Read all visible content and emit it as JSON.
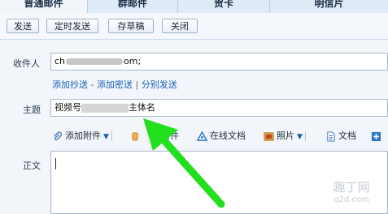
{
  "tabs": [
    "普通邮件",
    "群邮件",
    "贺卡",
    "明信片"
  ],
  "toolbar": {
    "send": "发送",
    "scheduled_send": "定时发送",
    "save_draft": "存草稿",
    "close": "关闭"
  },
  "recipient": {
    "label": "收件人",
    "value_start": "ch",
    "value_end": "om;"
  },
  "recipient_links": {
    "add_cc": "添加抄送",
    "dash1": "-",
    "add_bcc": "添加密送",
    "bar": "|",
    "separate_send": "分别发送"
  },
  "subject": {
    "label": "主题",
    "value_start": "视频号",
    "value_end": "主体名"
  },
  "attachments": {
    "add_attachment": "添加附件",
    "large_attachment": "附件",
    "online_doc": "在线文档",
    "photo": "照片",
    "document": "文档"
  },
  "body": {
    "label": "正文"
  },
  "watermark": {
    "line1": "趣丁网",
    "line2": "q2d.com"
  },
  "colors": {
    "tab_bar": "#a9c6e8",
    "link": "#1a5fb4",
    "arrow": "#22e01e"
  }
}
